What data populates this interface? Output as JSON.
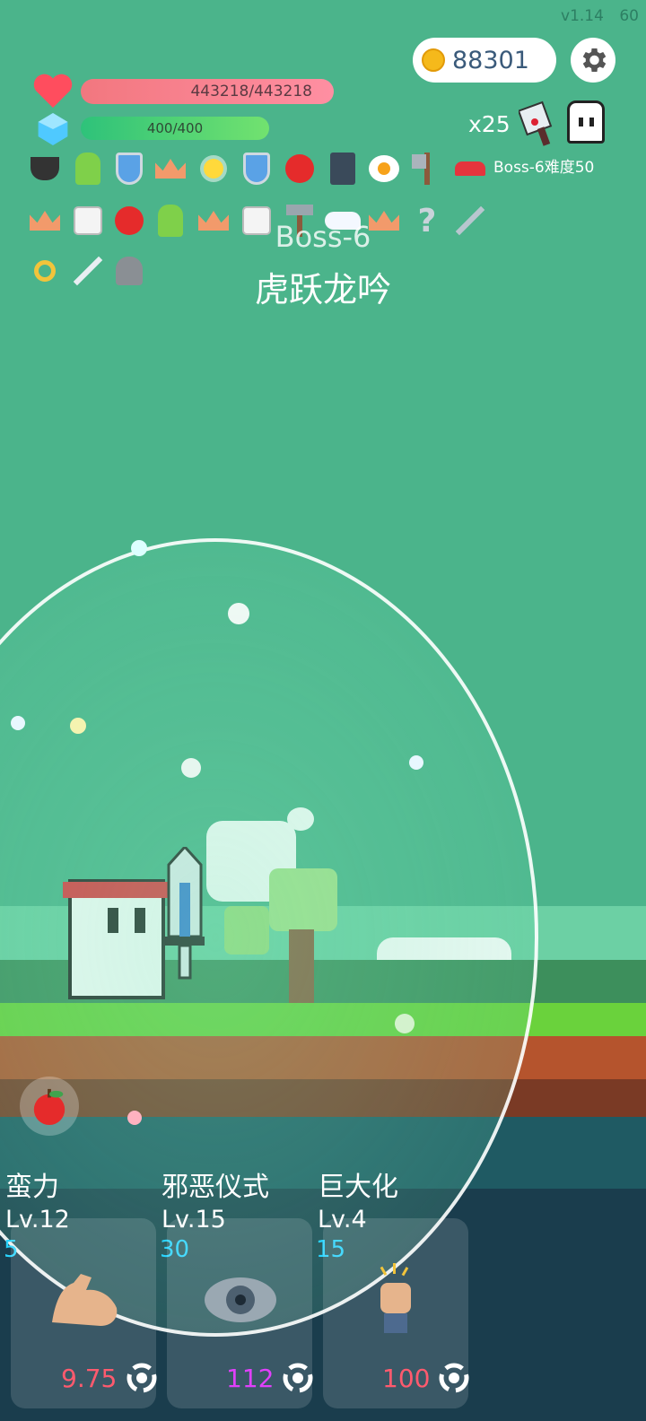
{
  "version": "v1.14",
  "fps": "60",
  "gold": "88301",
  "hp": "443218/443218",
  "hp_fraction": 1.0,
  "mp": "400/400",
  "mp_fraction": 1.0,
  "multiplier": "x25",
  "boss_difficulty": "Boss-6难度50",
  "boss": {
    "code": "Boss-6",
    "name": "虎跃龙吟"
  },
  "items_row1": [
    "cauldron-icon",
    "green-monster-icon",
    "shield-icon",
    "crown-icon",
    "lightbulb-icon",
    "shield-icon",
    "apple-icon",
    "skull-book-icon",
    "fried-egg-icon",
    "axe-icon",
    "sneaker-icon"
  ],
  "items_row2": [
    "crown-icon",
    "dice-icon",
    "apple-icon",
    "green-monster-icon",
    "crown-icon",
    "dice-icon",
    "hammer-icon",
    "wing-icon",
    "crown-icon",
    "question-mark-icon",
    "sword-icon"
  ],
  "items_row3": [
    "ring-icon",
    "sword-icon",
    "helmet-icon"
  ],
  "skills": [
    {
      "name": "蛮力",
      "level": "Lv.12",
      "cost": "5",
      "price": "9.75",
      "price_color": "#ff5a6e",
      "icon": "flexed-arm-icon"
    },
    {
      "name": "邪恶仪式",
      "level": "Lv.15",
      "cost": "30",
      "price": "112",
      "price_color": "#e040fb",
      "icon": "eye-icon"
    },
    {
      "name": "巨大化",
      "level": "Lv.4",
      "cost": "15",
      "price": "100",
      "price_color": "#ff5a6e",
      "icon": "snapping-fist-icon"
    }
  ],
  "colors": {
    "background": "#4bb48b",
    "hp": "#f2777f",
    "mp": "#2ec27a",
    "accent_cost": "#29d4ff"
  }
}
